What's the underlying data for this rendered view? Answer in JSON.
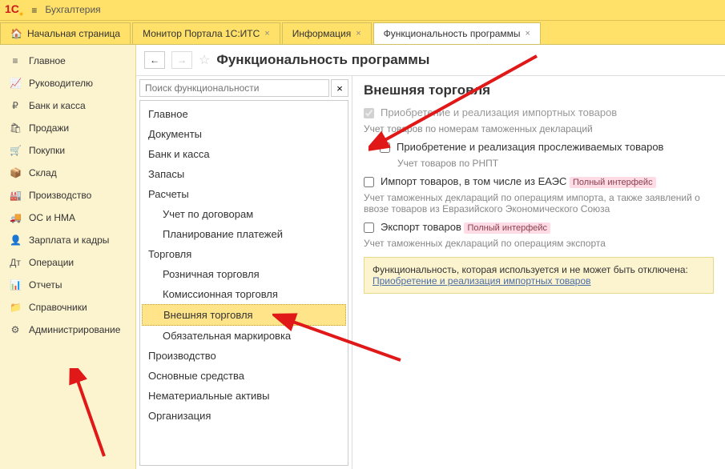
{
  "app": {
    "title": "Бухгалтерия"
  },
  "tabs": [
    {
      "label": "Начальная страница",
      "closable": false,
      "active": false,
      "home": true
    },
    {
      "label": "Монитор Портала 1С:ИТС",
      "closable": true,
      "active": false
    },
    {
      "label": "Информация",
      "closable": true,
      "active": false
    },
    {
      "label": "Функциональность программы",
      "closable": true,
      "active": true
    }
  ],
  "sidebar": [
    {
      "icon": "≡",
      "label": "Главное"
    },
    {
      "icon": "📈",
      "label": "Руководителю"
    },
    {
      "icon": "₽",
      "label": "Банк и касса"
    },
    {
      "icon": "🛍",
      "label": "Продажи"
    },
    {
      "icon": "🛒",
      "label": "Покупки"
    },
    {
      "icon": "📦",
      "label": "Склад"
    },
    {
      "icon": "🏭",
      "label": "Производство"
    },
    {
      "icon": "🚚",
      "label": "ОС и НМА"
    },
    {
      "icon": "👤",
      "label": "Зарплата и кадры"
    },
    {
      "icon": "Дт",
      "label": "Операции"
    },
    {
      "icon": "📊",
      "label": "Отчеты"
    },
    {
      "icon": "📁",
      "label": "Справочники"
    },
    {
      "icon": "⚙",
      "label": "Администрирование"
    }
  ],
  "page": {
    "title": "Функциональность программы"
  },
  "search": {
    "placeholder": "Поиск функциональности"
  },
  "tree": [
    {
      "label": "Главное",
      "lvl": 0
    },
    {
      "label": "Документы",
      "lvl": 0
    },
    {
      "label": "Банк и касса",
      "lvl": 0
    },
    {
      "label": "Запасы",
      "lvl": 0
    },
    {
      "label": "Расчеты",
      "lvl": 0
    },
    {
      "label": "Учет по договорам",
      "lvl": 1
    },
    {
      "label": "Планирование платежей",
      "lvl": 1
    },
    {
      "label": "Торговля",
      "lvl": 0
    },
    {
      "label": "Розничная торговля",
      "lvl": 1
    },
    {
      "label": "Комиссионная торговля",
      "lvl": 1
    },
    {
      "label": "Внешняя торговля",
      "lvl": 1,
      "selected": true
    },
    {
      "label": "Обязательная маркировка",
      "lvl": 1
    },
    {
      "label": "Производство",
      "lvl": 0
    },
    {
      "label": "Основные средства",
      "lvl": 0
    },
    {
      "label": "Нематериальные активы",
      "lvl": 0
    },
    {
      "label": "Организация",
      "lvl": 0
    }
  ],
  "detail": {
    "title": "Внешняя торговля",
    "item1_label": "Приобретение и реализация импортных товаров",
    "item1_desc": "Учет товаров по номерам таможенных деклараций",
    "item2_label": "Приобретение и реализация прослеживаемых товаров",
    "item2_desc": "Учет товаров по РНПТ",
    "item3_label": "Импорт товаров, в том числе из ЕАЭС",
    "item3_badge": "Полный интерфейс",
    "item3_desc": "Учет таможенных деклараций по операциям импорта, а также заявлений о ввозе товаров из Евразийского Экономического Союза",
    "item4_label": "Экспорт товаров",
    "item4_badge": "Полный интерфейс",
    "item4_desc": "Учет таможенных деклараций по операциям экспорта",
    "locked_heading": "Функциональность, которая используется и не может быть отключена:",
    "locked_link": "Приобретение и реализация импортных товаров"
  }
}
